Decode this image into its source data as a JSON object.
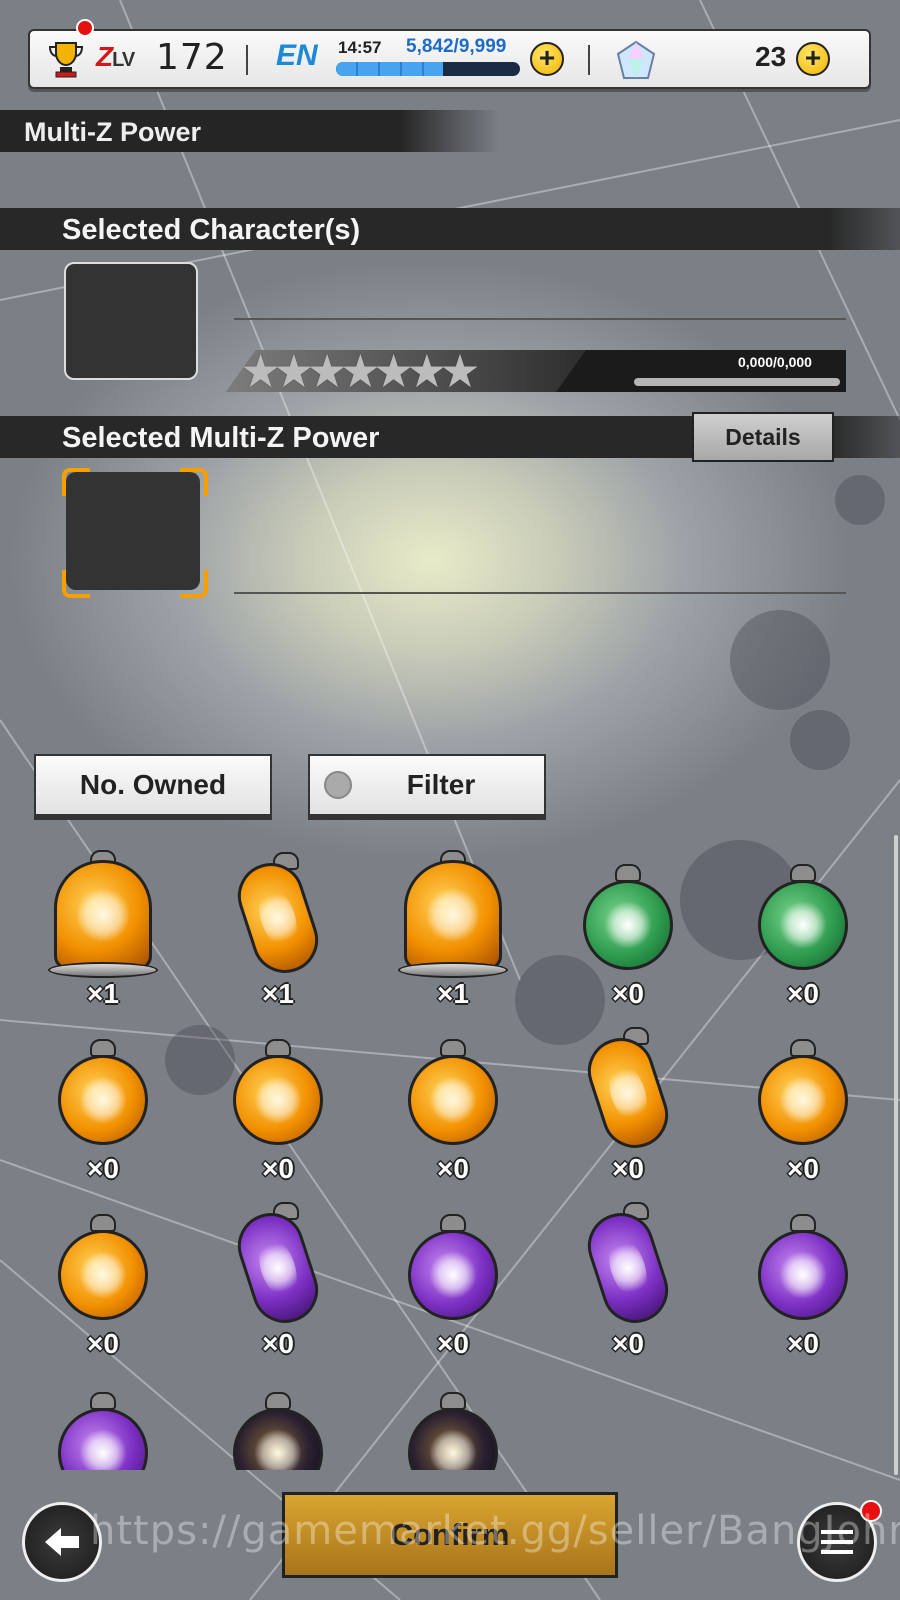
{
  "topbar": {
    "rank_prefix": "Z",
    "rank_suffix": "LV",
    "level": "172",
    "energy_label": "EN",
    "time": "14:57",
    "stamina": "5,842/9,999",
    "stamina_fraction": 0.584,
    "gems": "23",
    "plus_symbol": "+"
  },
  "header": {
    "title": "Multi-Z Power"
  },
  "selected_characters": {
    "title": "Selected Character(s)",
    "stars_count": 7,
    "stars": "★★★★★★★",
    "exp_text": "0,000/0,000"
  },
  "selected_multi_z": {
    "title": "Selected Multi-Z Power",
    "details_label": "Details"
  },
  "controls": {
    "sort_label": "No. Owned",
    "filter_label": "Filter"
  },
  "items": [
    {
      "type": "orange dome",
      "count": "×1"
    },
    {
      "type": "orange capsule",
      "count": "×1"
    },
    {
      "type": "orange dome",
      "count": "×1"
    },
    {
      "type": "green orb",
      "count": "×0"
    },
    {
      "type": "green orb",
      "count": "×0"
    },
    {
      "type": "orange orb",
      "count": "×0"
    },
    {
      "type": "orange orb",
      "count": "×0"
    },
    {
      "type": "orange orb",
      "count": "×0"
    },
    {
      "type": "orange capsule",
      "count": "×0"
    },
    {
      "type": "orange orb",
      "count": "×0"
    },
    {
      "type": "orange orb",
      "count": "×0"
    },
    {
      "type": "purple capsule",
      "count": "×0"
    },
    {
      "type": "purple orb",
      "count": "×0"
    },
    {
      "type": "purple capsule",
      "count": "×0"
    },
    {
      "type": "purple orb",
      "count": "×0"
    },
    {
      "type": "purple orb",
      "count": ""
    },
    {
      "type": "dark orb",
      "count": ""
    },
    {
      "type": "dark orb",
      "count": ""
    }
  ],
  "footer": {
    "confirm_label": "Confirm",
    "watermark": "https://gamemarket.gg/seller/BangJohn"
  }
}
